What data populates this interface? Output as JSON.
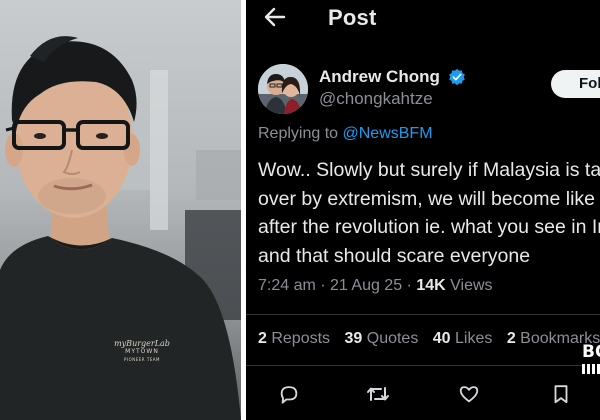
{
  "photo": {
    "shirt_brand": "myBurgerLab",
    "shirt_line1": "MYTOWN",
    "shirt_line2": "PIONEER TEAM"
  },
  "post": {
    "header": {
      "title": "Post",
      "back_icon": "arrow-left-icon"
    },
    "author": {
      "name": "Andrew Chong",
      "handle": "@chongkahtze",
      "verified": true,
      "verified_color": "#1d9bf0"
    },
    "follow_label": "Follow",
    "replying": {
      "prefix": "Replying to ",
      "mention": "@NewsBFM"
    },
    "text_lines": [
      "Wow.. Slowly but surely if Malaysia is taken",
      "over by extremism, we will become like Iran",
      "after the revolution ie. what you see in Iran now",
      "and that should scare everyone"
    ],
    "meta": {
      "time": "7:24 am",
      "dot": " · ",
      "date": "21 Aug 25",
      "views_count": "14K",
      "views_label": " Views"
    },
    "stats": {
      "reposts_count": "2",
      "reposts_label": " Reposts",
      "quotes_count": "39",
      "quotes_label": " Quotes",
      "likes_count": "40",
      "likes_label": " Likes",
      "bookmarks_count": "2",
      "bookmarks_label": " Bookmarks"
    },
    "actions": [
      "reply-icon",
      "repost-icon",
      "like-icon",
      "bookmark-icon"
    ],
    "colors": {
      "accent": "#1d9bf0",
      "background": "#000000",
      "muted": "#8b9096"
    }
  },
  "watermark": {
    "text": "BO"
  }
}
